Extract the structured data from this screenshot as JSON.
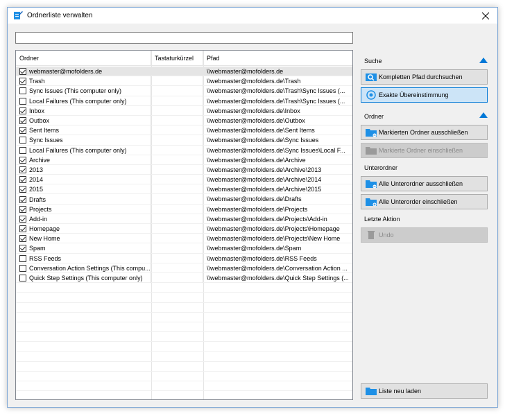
{
  "window": {
    "title": "Ordnerliste verwalten",
    "search_value": ""
  },
  "table": {
    "headers": [
      "Ordner",
      "Tastaturkürzel",
      "Pfad"
    ],
    "rows": [
      {
        "name": "webmaster@mofolders.de",
        "shortcut": "",
        "path": "\\\\webmaster@mofolders.de",
        "checked": true,
        "selected": true
      },
      {
        "name": "Trash",
        "shortcut": "",
        "path": "\\\\webmaster@mofolders.de\\Trash",
        "checked": true
      },
      {
        "name": "Sync Issues (This computer only)",
        "shortcut": "",
        "path": "\\\\webmaster@mofolders.de\\Trash\\Sync Issues (...",
        "checked": false
      },
      {
        "name": "Local Failures (This computer only)",
        "shortcut": "",
        "path": "\\\\webmaster@mofolders.de\\Trash\\Sync Issues (...",
        "checked": false
      },
      {
        "name": "Inbox",
        "shortcut": "",
        "path": "\\\\webmaster@mofolders.de\\Inbox",
        "checked": true
      },
      {
        "name": "Outbox",
        "shortcut": "",
        "path": "\\\\webmaster@mofolders.de\\Outbox",
        "checked": true
      },
      {
        "name": "Sent Items",
        "shortcut": "",
        "path": "\\\\webmaster@mofolders.de\\Sent Items",
        "checked": true
      },
      {
        "name": "Sync Issues",
        "shortcut": "",
        "path": "\\\\webmaster@mofolders.de\\Sync Issues",
        "checked": false
      },
      {
        "name": "Local Failures (This computer only)",
        "shortcut": "",
        "path": "\\\\webmaster@mofolders.de\\Sync Issues\\Local F...",
        "checked": false
      },
      {
        "name": "Archive",
        "shortcut": "",
        "path": "\\\\webmaster@mofolders.de\\Archive",
        "checked": true
      },
      {
        "name": "2013",
        "shortcut": "",
        "path": "\\\\webmaster@mofolders.de\\Archive\\2013",
        "checked": true
      },
      {
        "name": "2014",
        "shortcut": "",
        "path": "\\\\webmaster@mofolders.de\\Archive\\2014",
        "checked": true
      },
      {
        "name": "2015",
        "shortcut": "",
        "path": "\\\\webmaster@mofolders.de\\Archive\\2015",
        "checked": true
      },
      {
        "name": "Drafts",
        "shortcut": "",
        "path": "\\\\webmaster@mofolders.de\\Drafts",
        "checked": true
      },
      {
        "name": "Projects",
        "shortcut": "",
        "path": "\\\\webmaster@mofolders.de\\Projects",
        "checked": true
      },
      {
        "name": "Add-in",
        "shortcut": "",
        "path": "\\\\webmaster@mofolders.de\\Projects\\Add-in",
        "checked": true
      },
      {
        "name": "Homepage",
        "shortcut": "",
        "path": "\\\\webmaster@mofolders.de\\Projects\\Homepage",
        "checked": true
      },
      {
        "name": "New Home",
        "shortcut": "",
        "path": "\\\\webmaster@mofolders.de\\Projects\\New Home",
        "checked": true
      },
      {
        "name": "Spam",
        "shortcut": "",
        "path": "\\\\webmaster@mofolders.de\\Spam",
        "checked": true
      },
      {
        "name": "RSS Feeds",
        "shortcut": "",
        "path": "\\\\webmaster@mofolders.de\\RSS Feeds",
        "checked": false
      },
      {
        "name": "Conversation Action Settings (This compu...",
        "shortcut": "",
        "path": "\\\\webmaster@mofolders.de\\Conversation Action ...",
        "checked": false
      },
      {
        "name": "Quick Step Settings (This computer only)",
        "shortcut": "",
        "path": "\\\\webmaster@mofolders.de\\Quick Step Settings (...",
        "checked": false
      }
    ]
  },
  "sidebar": {
    "suche_label": "Suche",
    "search_full_path": "Kompletten Pfad durchsuchen",
    "exact_match": "Exakte Übereinstimmung",
    "ordner_label": "Ordner",
    "exclude_marked": "Markierten Ordner ausschließen",
    "include_marked": "Markierte Ordner einschließen",
    "unterordner_label": "Unterordner",
    "exclude_all_sub": "Alle Unterordner ausschließen",
    "include_all_sub": "Alle Unterorder einschließen",
    "letzte_aktion_label": "Letzte Aktion",
    "undo": "Undo",
    "reload": "Liste neu laden"
  },
  "colors": {
    "accent": "#0078d7",
    "folder_blue": "#1e90e6",
    "active_button_bg": "#cce4f7"
  },
  "icons": {
    "title": "edit-list-icon",
    "close": "close-icon",
    "search": "search-icon",
    "exact": "target-search-icon",
    "folder": "folder-icon",
    "trash": "trash-icon"
  }
}
